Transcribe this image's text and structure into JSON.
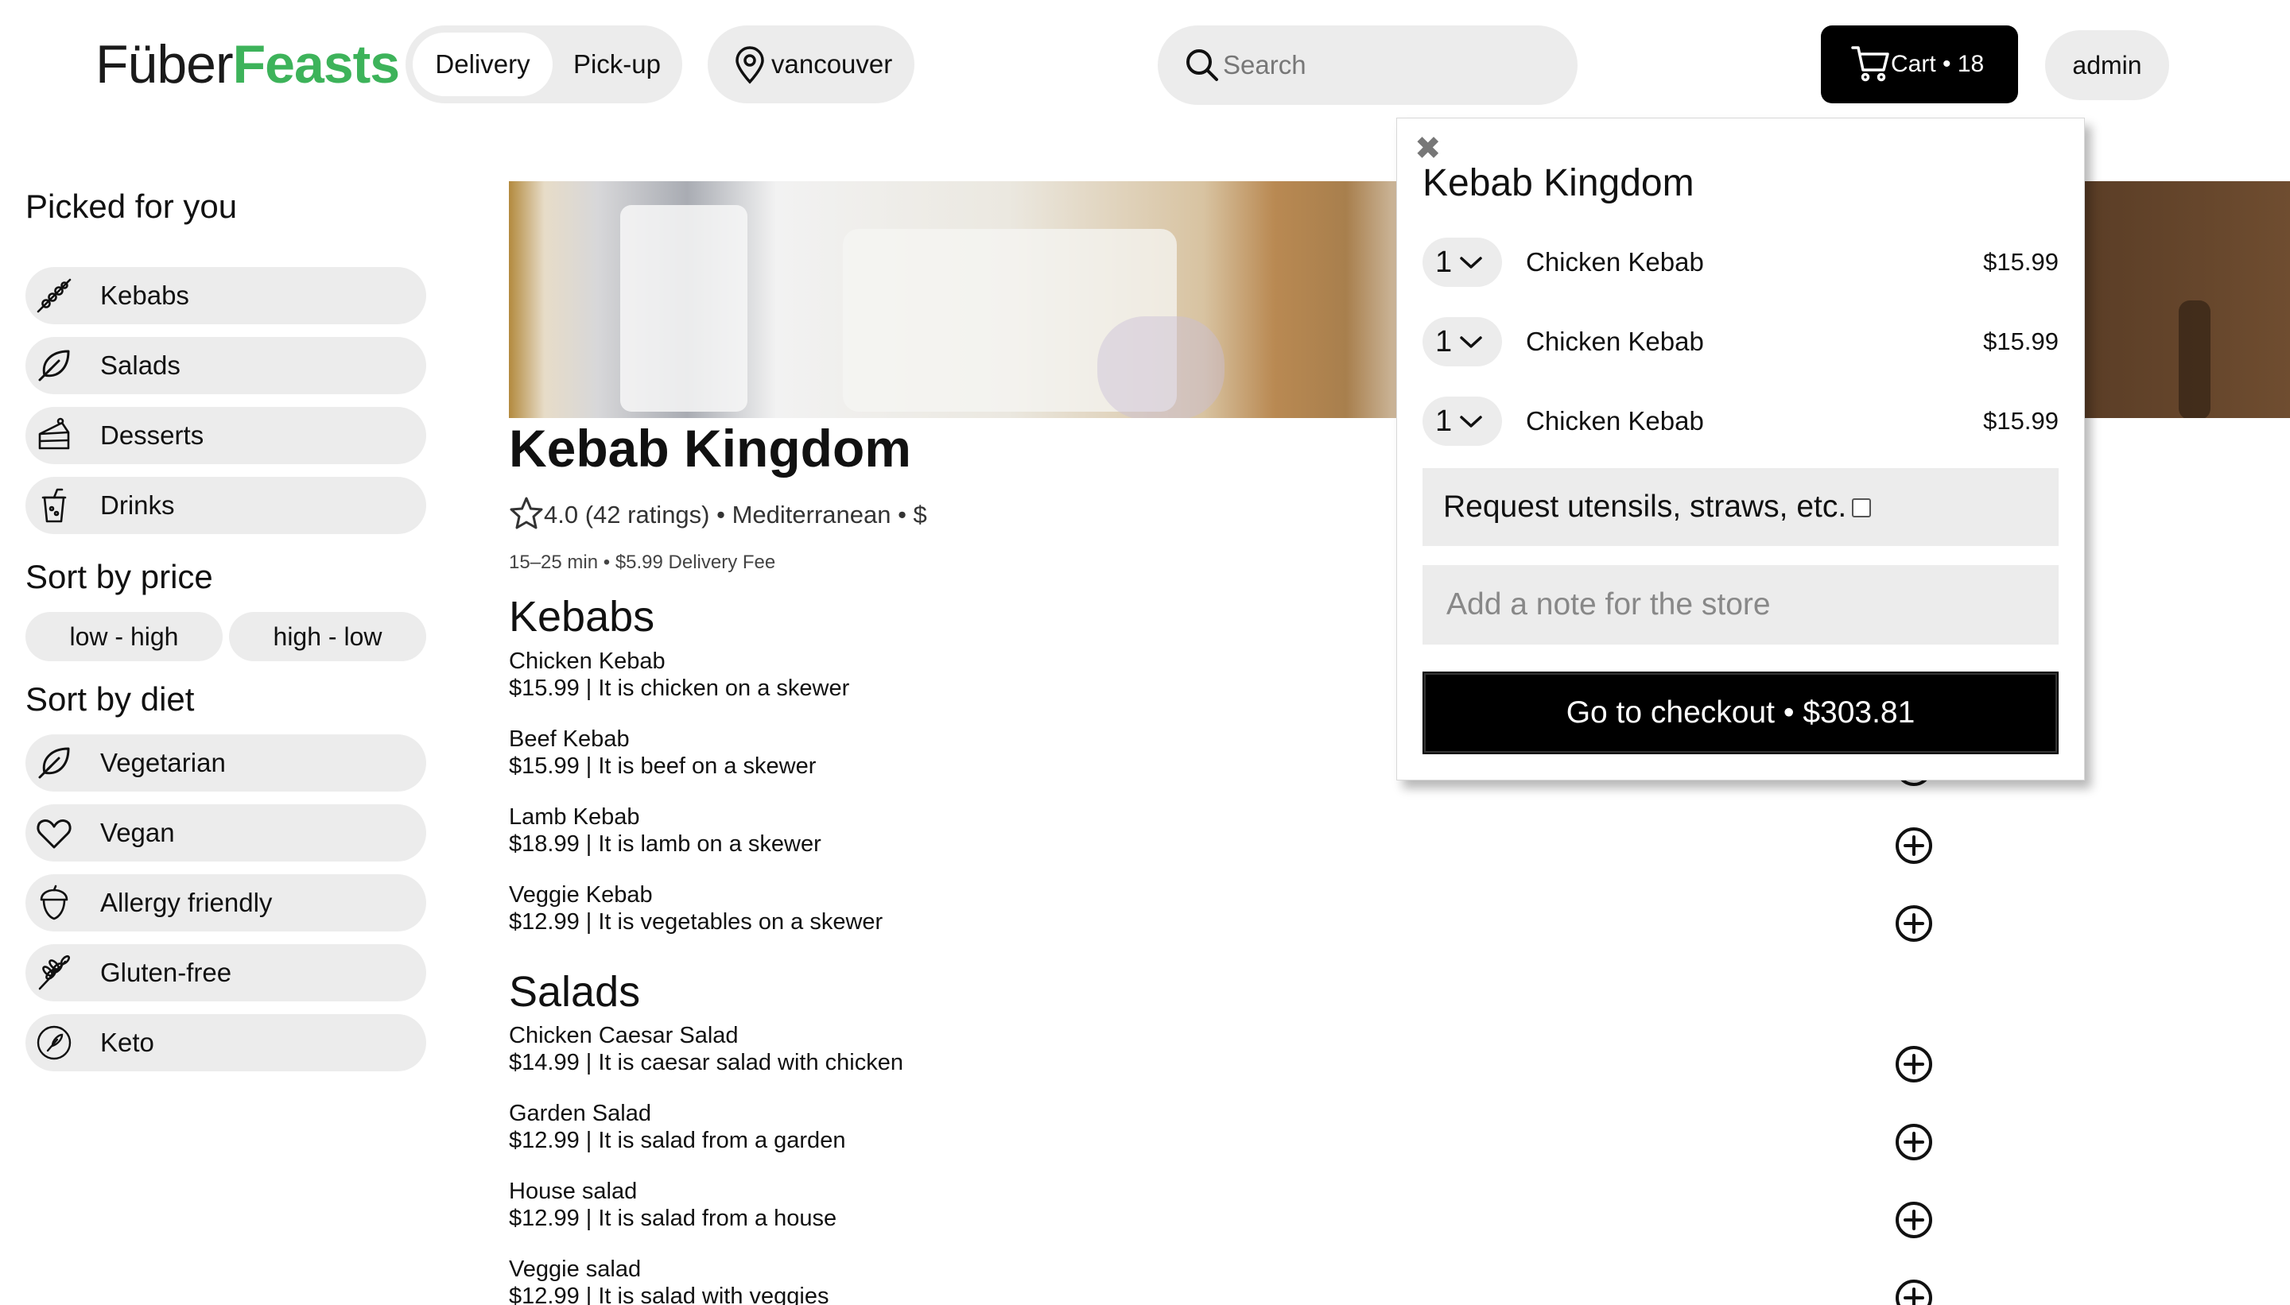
{
  "header": {
    "logo_part1": "Füber",
    "logo_part2": "Feasts",
    "mode_active": "Delivery",
    "mode_other": "Pick-up",
    "location": "vancouver",
    "search_placeholder": "Search",
    "cart_label": "Cart • 18",
    "user": "admin",
    "accent_color": "#3db35a"
  },
  "sidebar": {
    "picked_title": "Picked for you",
    "picked_items": [
      {
        "label": "Kebabs",
        "icon": "skewer-icon"
      },
      {
        "label": "Salads",
        "icon": "leaf-icon"
      },
      {
        "label": "Desserts",
        "icon": "cake-icon"
      },
      {
        "label": "Drinks",
        "icon": "drink-icon"
      }
    ],
    "price_title": "Sort by price",
    "price_low_high": "low - high",
    "price_high_low": "high - low",
    "diet_title": "Sort by diet",
    "diet_items": [
      {
        "label": "Vegetarian",
        "icon": "leaf-icon"
      },
      {
        "label": "Vegan",
        "icon": "heart-icon"
      },
      {
        "label": "Allergy friendly",
        "icon": "acorn-icon"
      },
      {
        "label": "Gluten-free",
        "icon": "wheat-icon"
      },
      {
        "label": "Keto",
        "icon": "keto-icon"
      }
    ]
  },
  "restaurant": {
    "name": "Kebab Kingdom",
    "rating_line": "4.0 (42 ratings) • Mediterranean • $",
    "delivery_line": "15–25 min • $5.99 Delivery Fee"
  },
  "menu": {
    "sections": [
      {
        "title": "Kebabs",
        "items": [
          {
            "name": "Chicken Kebab",
            "detail": "$15.99 | It is chicken on a skewer"
          },
          {
            "name": "Beef Kebab",
            "detail": "$15.99 | It is beef on a skewer"
          },
          {
            "name": "Lamb Kebab",
            "detail": "$18.99 | It is lamb on a skewer"
          },
          {
            "name": "Veggie Kebab",
            "detail": "$12.99 | It is vegetables on a skewer"
          }
        ]
      },
      {
        "title": "Salads",
        "items": [
          {
            "name": "Chicken Caesar Salad",
            "detail": "$14.99 | It is caesar salad with chicken"
          },
          {
            "name": "Garden Salad",
            "detail": "$12.99 | It is salad from a garden"
          },
          {
            "name": "House salad",
            "detail": "$12.99 | It is salad from a house"
          },
          {
            "name": "Veggie salad",
            "detail": "$12.99 | It is salad with veggies"
          }
        ]
      }
    ]
  },
  "cart_popup": {
    "title": "Kebab Kingdom",
    "items": [
      {
        "qty": "1",
        "name": "Chicken Kebab",
        "price": "$15.99"
      },
      {
        "qty": "1",
        "name": "Chicken Kebab",
        "price": "$15.99"
      },
      {
        "qty": "1",
        "name": "Chicken Kebab",
        "price": "$15.99"
      }
    ],
    "utensils_label": "Request utensils, straws, etc.",
    "note_placeholder": "Add a note for the store",
    "checkout_label": "Go to checkout • $303.81"
  }
}
